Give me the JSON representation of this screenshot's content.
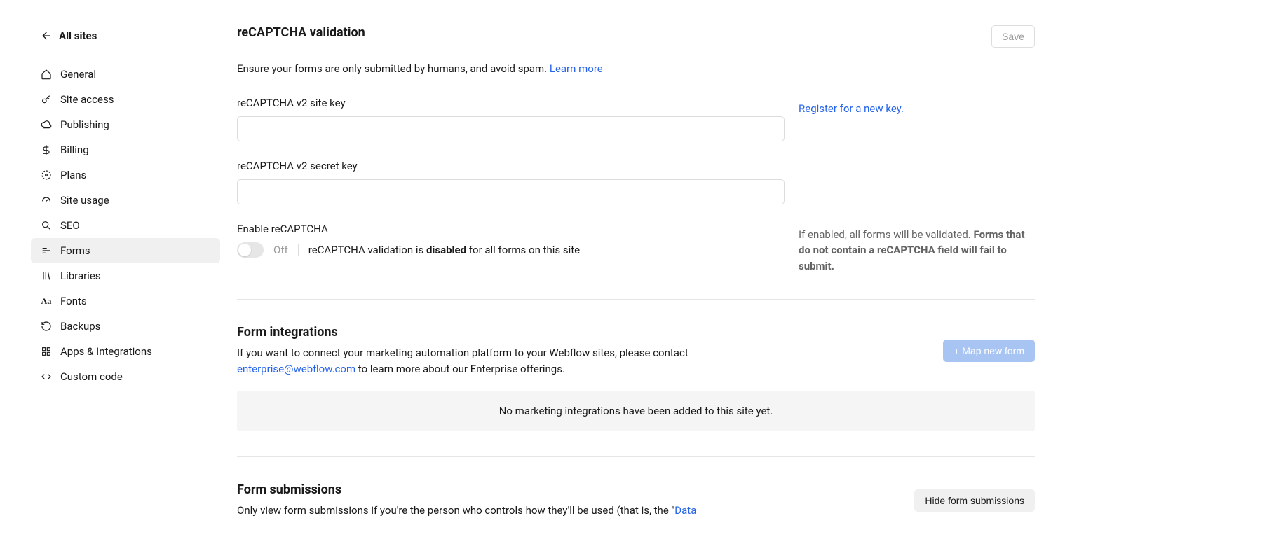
{
  "sidebar": {
    "back_label": "All sites",
    "items": [
      {
        "id": "general",
        "label": "General",
        "icon": "home"
      },
      {
        "id": "site-access",
        "label": "Site access",
        "icon": "key"
      },
      {
        "id": "publishing",
        "label": "Publishing",
        "icon": "cloud"
      },
      {
        "id": "billing",
        "label": "Billing",
        "icon": "dollar"
      },
      {
        "id": "plans",
        "label": "Plans",
        "icon": "gauge"
      },
      {
        "id": "site-usage",
        "label": "Site usage",
        "icon": "speedometer"
      },
      {
        "id": "seo",
        "label": "SEO",
        "icon": "search"
      },
      {
        "id": "forms",
        "label": "Forms",
        "icon": "lines",
        "active": true
      },
      {
        "id": "libraries",
        "label": "Libraries",
        "icon": "books"
      },
      {
        "id": "fonts",
        "label": "Fonts",
        "icon": "aa"
      },
      {
        "id": "backups",
        "label": "Backups",
        "icon": "refresh"
      },
      {
        "id": "apps",
        "label": "Apps & Integrations",
        "icon": "grid"
      },
      {
        "id": "custom-code",
        "label": "Custom code",
        "icon": "code"
      }
    ]
  },
  "recaptcha": {
    "title": "reCAPTCHA validation",
    "save_button": "Save",
    "desc_prefix": "Ensure your forms are only submitted by humans, and avoid spam. ",
    "learn_more": "Learn more",
    "site_key_label": "reCAPTCHA v2 site key",
    "site_key_value": "",
    "register_link": "Register for a new key.",
    "secret_key_label": "reCAPTCHA v2 secret key",
    "secret_key_value": "",
    "enable_label": "Enable reCAPTCHA",
    "toggle_state": "Off",
    "status_prefix": "reCAPTCHA validation is ",
    "status_bold": "disabled",
    "status_suffix": " for all forms on this site",
    "side_desc_prefix": "If enabled, all forms will be validated. ",
    "side_desc_bold": "Forms that do not contain a reCAPTCHA field will fail to submit."
  },
  "integrations": {
    "title": "Form integrations",
    "map_button": "+ Map new form",
    "desc_prefix": "If you want to connect your marketing automation platform to your Webflow sites, please contact ",
    "email_link": "enterprise@webflow.com",
    "desc_suffix": " to learn more about our Enterprise offerings.",
    "empty_msg": "No marketing integrations have been added to this site yet."
  },
  "submissions": {
    "title": "Form submissions",
    "hide_button": "Hide form submissions",
    "desc_prefix": "Only view form submissions if you're the person who controls how they'll be used (that is, the \"",
    "link_text": "Data"
  }
}
